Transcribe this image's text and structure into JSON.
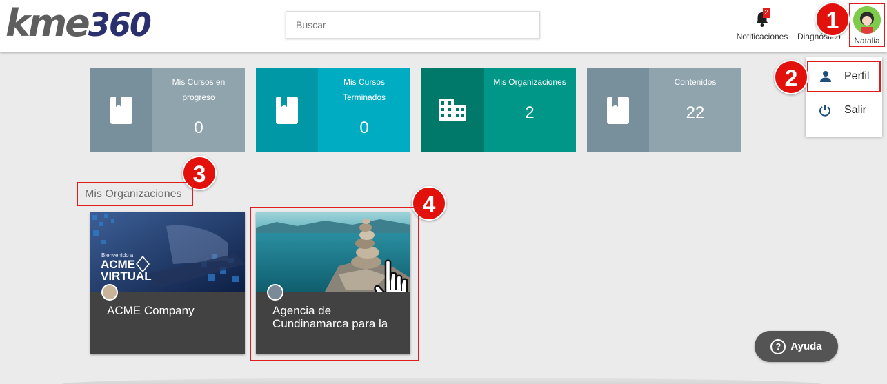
{
  "header": {
    "logo_part1": "kme",
    "logo_part2": "360",
    "search_placeholder": "Buscar",
    "notifications_label": "Notificaciones",
    "notifications_count": "2",
    "diagnostics_label": "Diagnóstico",
    "user_name": "Natalia"
  },
  "user_menu": {
    "items": [
      {
        "label": "Perfil",
        "icon": "person-icon"
      },
      {
        "label": "Salir",
        "icon": "power-icon"
      }
    ]
  },
  "stats": [
    {
      "title": "Mis Cursos en progreso",
      "value": "0",
      "icon": "book-icon",
      "color": "#90a4ae"
    },
    {
      "title": "Mis Cursos Terminados",
      "value": "0",
      "icon": "book-icon",
      "color": "#00acc1"
    },
    {
      "title": "Mis Organizaciones",
      "value": "2",
      "icon": "building-icon",
      "color": "#009688"
    },
    {
      "title": "Contenidos",
      "value": "22",
      "icon": "book-icon",
      "color": "#90a4ae"
    }
  ],
  "section_title": "Mis Organizaciones",
  "organizations": [
    {
      "name": "ACME Company",
      "banner_line1": "Bienvenido a",
      "banner_line2": "ACME",
      "banner_line3": "VIRTUAL"
    },
    {
      "name": "Agencia de Cundinamarca para la"
    }
  ],
  "markers": [
    "1",
    "2",
    "3",
    "4"
  ],
  "help_label": "Ayuda",
  "colors": {
    "highlight": "#e01d1d",
    "marker": "#e3110b"
  }
}
